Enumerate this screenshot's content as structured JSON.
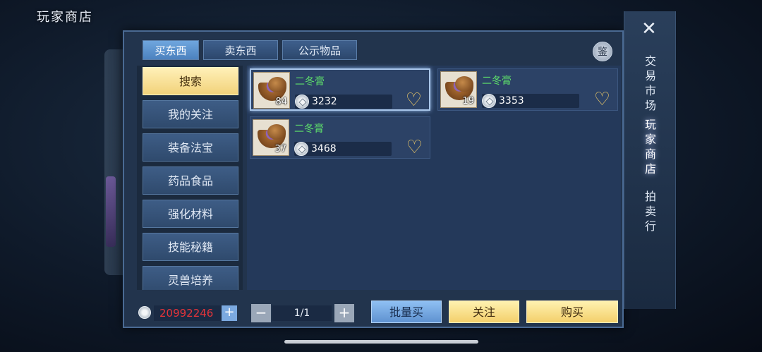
{
  "screen_title": "玩家商店",
  "tabs": [
    {
      "label": "买东西",
      "active": true
    },
    {
      "label": "卖东西",
      "active": false
    },
    {
      "label": "公示物品",
      "active": false
    }
  ],
  "appraise_label": "鉴",
  "categories": [
    {
      "label": "搜索",
      "active": true
    },
    {
      "label": "我的关注",
      "active": false
    },
    {
      "label": "装备法宝",
      "active": false
    },
    {
      "label": "药品食品",
      "active": false
    },
    {
      "label": "强化材料",
      "active": false
    },
    {
      "label": "技能秘籍",
      "active": false
    },
    {
      "label": "灵兽培养",
      "active": false
    }
  ],
  "items": [
    {
      "name": "二冬膏",
      "qty": "84",
      "price": "3232",
      "selected": true
    },
    {
      "name": "二冬膏",
      "qty": "19",
      "price": "3353",
      "selected": false
    },
    {
      "name": "二冬膏",
      "qty": "37",
      "price": "3468",
      "selected": false
    }
  ],
  "footer": {
    "balance": "20992246",
    "add": "+",
    "minus": "−",
    "plus": "+",
    "page": "1/1",
    "bulk_buy": "批量买",
    "follow": "关注",
    "buy": "购买"
  },
  "rail": {
    "close": "✕",
    "items": [
      {
        "label": "交\n易\n市\n场",
        "active": false
      },
      {
        "label": "玩\n家\n商\n店",
        "active": true
      },
      {
        "label": "拍\n卖\n行",
        "active": false
      }
    ]
  },
  "icons": {
    "coin": "coin-icon",
    "heart": "heart-icon",
    "chevron": "chevron-down-icon"
  },
  "colors": {
    "accent_gold": "#f3cf6b",
    "accent_blue": "#5f92d0",
    "item_name": "#5ee06b",
    "balance": "#e4343a"
  }
}
